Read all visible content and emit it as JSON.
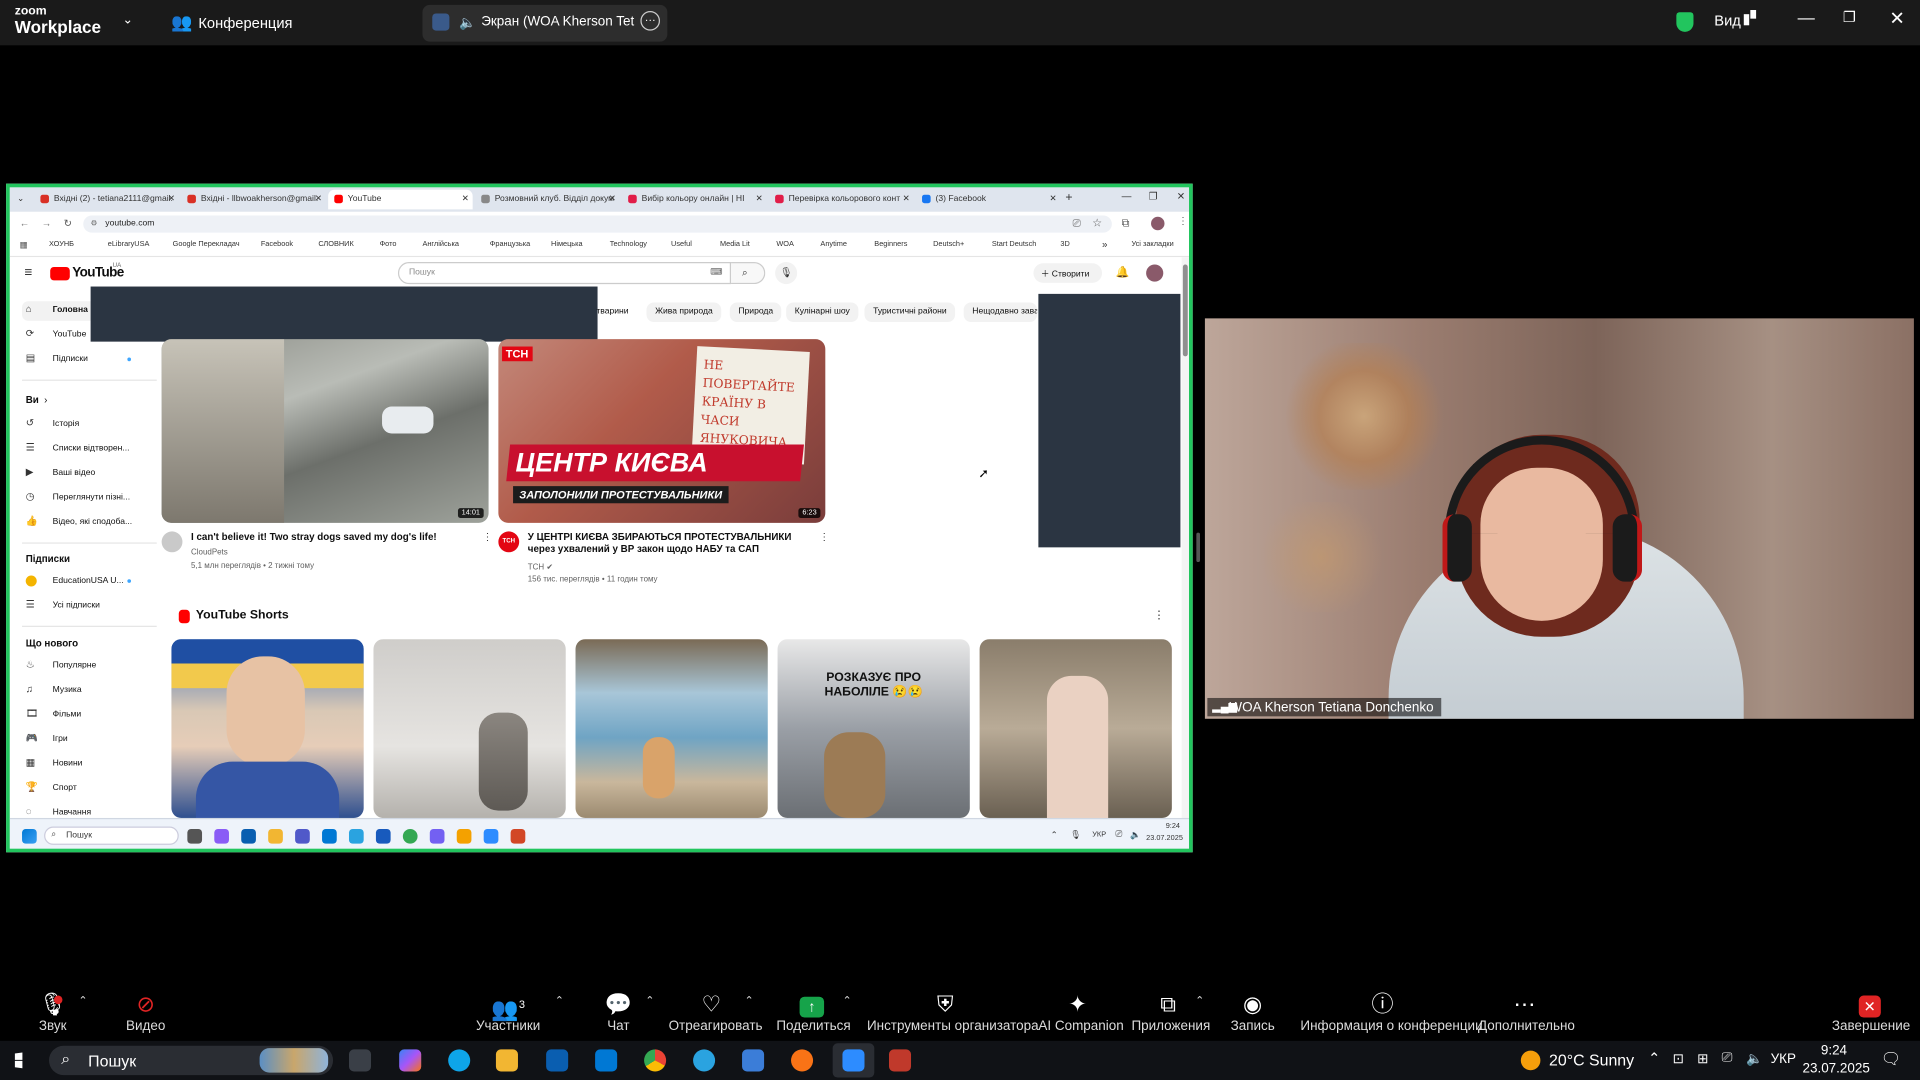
{
  "zoom": {
    "logo_line1": "zoom",
    "logo_line2": "Workplace",
    "meeting_label": "Конференция",
    "share_label": "Экран (WOA Kherson Tetiana",
    "view_label": "Вид"
  },
  "browser": {
    "tabs": [
      {
        "label": "Вхідні (2) - tetiana2111@gmail.",
        "color": "#d93025"
      },
      {
        "label": "Вхідні - llbwoakherson@gmail.",
        "color": "#d93025"
      },
      {
        "label": "YouTube",
        "color": "#ff0000"
      },
      {
        "label": "Розмовний клуб. Відділ докум",
        "color": "#888888"
      },
      {
        "label": "Вибір кольору онлайн | HI",
        "color": "#e11d48"
      },
      {
        "label": "Перевірка кольорового конт",
        "color": "#e11d48"
      },
      {
        "label": "(3) Facebook",
        "color": "#1877f2"
      }
    ],
    "url": "youtube.com",
    "bookmarks": [
      "ХОУНБ",
      "eLibraryUSA",
      "Google Перекладач",
      "Facebook",
      "СЛОВНИК",
      "Фото",
      "Англійська",
      "Французька",
      "Німецька",
      "Technology",
      "Useful",
      "Media Lit",
      "WOA",
      "Anytime",
      "Beginners",
      "Deutsch+",
      "Start Deutsch",
      "3D"
    ],
    "all_bookmarks": "Усі закладки"
  },
  "youtube": {
    "logo": "YouTube",
    "region": "UA",
    "search_placeholder": "Пошук",
    "create_label": "Створити",
    "sidebar": {
      "main": [
        {
          "label": "Головна",
          "icon": "home-icon"
        },
        {
          "label": "YouTube",
          "icon": "shorts-icon"
        },
        {
          "label": "Підписки",
          "icon": "subscriptions-icon"
        }
      ],
      "you_heading": "Ви",
      "you_items": [
        {
          "label": "Історія",
          "icon": "history-icon"
        },
        {
          "label": "Списки відтворен...",
          "icon": "playlist-icon"
        },
        {
          "label": "Ваші відео",
          "icon": "video-icon"
        },
        {
          "label": "Переглянути пізні...",
          "icon": "clock-icon"
        },
        {
          "label": "Відео, які сподоба...",
          "icon": "like-icon"
        }
      ],
      "subs_heading": "Підписки",
      "subs_items": [
        {
          "label": "EducationUSA U..."
        },
        {
          "label": "Усі підписки"
        }
      ],
      "new_heading": "Що нового",
      "new_items": [
        {
          "label": "Популярне",
          "icon": "fire-icon"
        },
        {
          "label": "Музика",
          "icon": "music-icon"
        },
        {
          "label": "Фільми",
          "icon": "film-icon"
        },
        {
          "label": "Ігри",
          "icon": "game-icon"
        },
        {
          "label": "Новини",
          "icon": "news-icon"
        },
        {
          "label": "Спорт",
          "icon": "trophy-icon"
        },
        {
          "label": "Навчання",
          "icon": "learning-icon"
        }
      ]
    },
    "chips": [
      "тварини",
      "Жива природа",
      "Природа",
      "Кулінарні шоу",
      "Туристичні райони",
      "Нещодавно заван"
    ],
    "videos": [
      {
        "title": "I can't believe it! Two stray dogs saved my dog's life!",
        "channel": "CloudPets",
        "meta": "5,1 млн переглядів • 2 тижні тому",
        "duration": "14:01"
      },
      {
        "title": "У ЦЕНТРІ КИЄВА ЗБИРАЮТЬСЯ ПРОТЕСТУВАЛЬНИКИ через ухвалений у ВР закон щодо НАБУ та САП",
        "channel": "ТСН",
        "meta": "156 тис. переглядів • 11 годин тому",
        "duration": "6:23",
        "thumb_headline": "ЦЕНТР КИЄВА",
        "thumb_sub": "ЗАПОЛОНИЛИ ПРОТЕСТУВАЛЬНИКИ",
        "thumb_sign": "НЕ ПОВЕРТАЙТЕ КРАЇНУ В ЧАСИ ЯНУКОВИЧА",
        "thumb_logo": "ТСН"
      }
    ],
    "shorts_heading": "YouTube Shorts",
    "short_caption": "РОЗКАЗУЄ ПРО НАБОЛІЛЕ 😢😢"
  },
  "shared_taskbar": {
    "search": "Пошук",
    "lang": "УКР",
    "time": "9:24",
    "date": "23.07.2025"
  },
  "participant": {
    "name": "WOA Kherson Tetiana Donchenko"
  },
  "controls": [
    {
      "label": "Звук",
      "icon": "microphone-icon"
    },
    {
      "label": "Видео",
      "icon": "video-off-icon"
    },
    {
      "label": "Участники",
      "icon": "participants-icon",
      "count": "3"
    },
    {
      "label": "Чат",
      "icon": "chat-icon"
    },
    {
      "label": "Отреагировать",
      "icon": "heart-icon"
    },
    {
      "label": "Поделиться",
      "icon": "share-icon"
    },
    {
      "label": "Инструменты организатора",
      "icon": "shield-icon"
    },
    {
      "label": "AI Companion",
      "icon": "sparkle-icon"
    },
    {
      "label": "Приложения",
      "icon": "apps-icon"
    },
    {
      "label": "Запись",
      "icon": "record-icon"
    },
    {
      "label": "Информация о конференции",
      "icon": "info-icon"
    },
    {
      "label": "Дополнительно",
      "icon": "more-icon"
    },
    {
      "label": "Завершение",
      "icon": "end-icon"
    }
  ],
  "taskbar": {
    "search": "Пошук",
    "weather": "20°C Sunny",
    "lang": "УКР",
    "time": "9:24",
    "date": "23.07.2025"
  },
  "colors": {
    "share_border": "#22c55e",
    "zoom_share_button": "#16a34a",
    "end_button": "#e02424",
    "youtube_red": "#ff0000"
  }
}
